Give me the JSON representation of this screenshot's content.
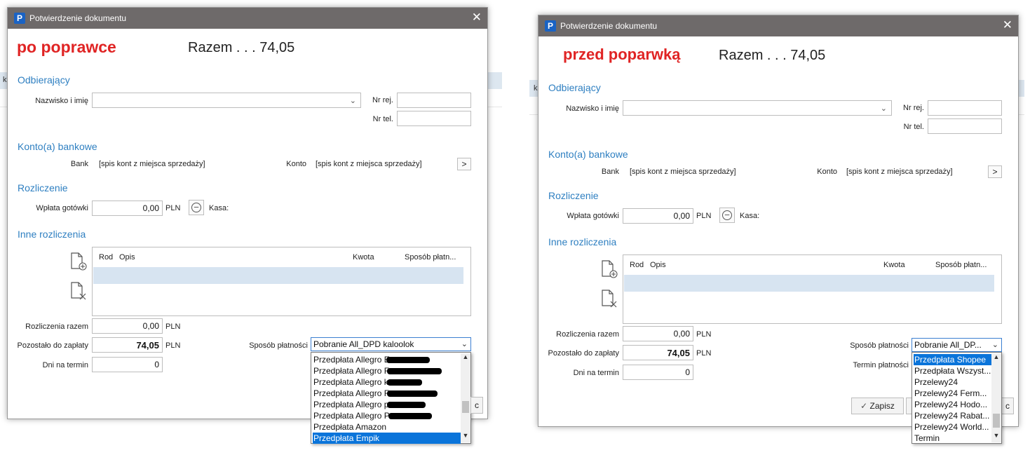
{
  "bg_fragment": "k",
  "left": {
    "window_title": "Potwierdzenie dokumentu",
    "annotation": "po poprawce",
    "total": "Razem . . . 74,05",
    "recipient": {
      "section": "Odbierający",
      "name_label": "Nazwisko i imię",
      "name_value": "",
      "reg_label": "Nr rej.",
      "reg_value": "",
      "tel_label": "Nr tel.",
      "tel_value": ""
    },
    "bank": {
      "section": "Konto(a) bankowe",
      "bank_label": "Bank",
      "bank_value": "[spis kont z miejsca sprzedaży]",
      "account_label": "Konto",
      "account_value": "[spis kont z miejsca sprzedaży]",
      "more": ">"
    },
    "settlement": {
      "section": "Rozliczenie",
      "cash_label": "Wpłata gotówki",
      "cash_value": "0,00",
      "currency": "PLN",
      "till_label": "Kasa:"
    },
    "other": {
      "section": "Inne rozliczenia",
      "columns": {
        "rod": "Rod",
        "opis": "Opis",
        "kwota": "Kwota",
        "sposob": "Sposób płatn..."
      }
    },
    "summary": {
      "total_label": "Rozliczenia razem",
      "total_value": "0,00",
      "remaining_label": "Pozostało do zapłaty",
      "remaining_value": "74,05",
      "days_label": "Dni na termin",
      "days_value": "0",
      "currency": "PLN"
    },
    "payment": {
      "label": "Sposób płatności",
      "selected": "Pobranie All_DPD kaloolok",
      "options": [
        {
          "text": "Przedpłata Allegro E",
          "redacted": true
        },
        {
          "text": "Przedpłata Allegro F",
          "redacted": true
        },
        {
          "text": "Przedpłata Allegro k",
          "redacted": true
        },
        {
          "text": "Przedpłata Allegro F",
          "redacted": true
        },
        {
          "text": "Przedpłata Allegro p",
          "redacted": true
        },
        {
          "text": "Przedpłata Allegro P",
          "redacted": true
        },
        {
          "text": "Przedpłata Amazon",
          "redacted": false
        },
        {
          "text": "Przedpłata Empik",
          "redacted": false,
          "selected": true
        }
      ]
    },
    "partial_button": "c"
  },
  "right": {
    "window_title": "Potwierdzenie dokumentu",
    "annotation": "przed poparwką",
    "total": "Razem . . . 74,05",
    "recipient": {
      "section": "Odbierający",
      "name_label": "Nazwisko i imię",
      "name_value": "",
      "reg_label": "Nr rej.",
      "reg_value": "",
      "tel_label": "Nr tel.",
      "tel_value": ""
    },
    "bank": {
      "section": "Konto(a) bankowe",
      "bank_label": "Bank",
      "bank_value": "[spis kont z miejsca sprzedaży]",
      "account_label": "Konto",
      "account_value": "[spis kont z miejsca sprzedaży]",
      "more": ">"
    },
    "settlement": {
      "section": "Rozliczenie",
      "cash_label": "Wpłata gotówki",
      "cash_value": "0,00",
      "currency": "PLN",
      "till_label": "Kasa:"
    },
    "other": {
      "section": "Inne rozliczenia",
      "columns": {
        "rod": "Rod",
        "opis": "Opis",
        "kwota": "Kwota",
        "sposob": "Sposób płatn..."
      }
    },
    "summary": {
      "total_label": "Rozliczenia razem",
      "total_value": "0,00",
      "remaining_label": "Pozostało do zapłaty",
      "remaining_value": "74,05",
      "days_label": "Dni na termin",
      "days_value": "0",
      "currency": "PLN"
    },
    "payment": {
      "label": "Sposób płatności",
      "selected": "Pobranie All_DP...",
      "term_label": "Termin płatności",
      "options": [
        {
          "text": "Przedpłata Shopee",
          "selected": true
        },
        {
          "text": "Przedpłata Wszyst..."
        },
        {
          "text": "Przelewy24"
        },
        {
          "text": "Przelewy24 Ferm..."
        },
        {
          "text": "Przelewy24 Hodo..."
        },
        {
          "text": "Przelewy24 Rabat..."
        },
        {
          "text": "Przelewy24 World..."
        },
        {
          "text": "Termin"
        }
      ]
    },
    "save_button": "Zapisz",
    "partial_button": "c"
  }
}
